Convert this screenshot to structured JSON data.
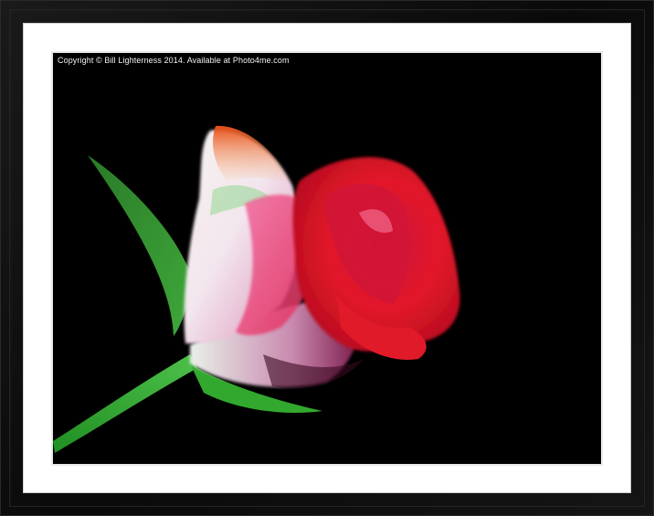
{
  "photo": {
    "watermark": "Copyright © Bill Lighterness 2014. Available at Photo4me.com",
    "subject": "rose-bud",
    "colors": {
      "background": "#000000",
      "frame": "#111111",
      "mount": "#ffffff",
      "petal_red": "#e0142a",
      "petal_pink": "#e85a8a",
      "petal_white": "#f4eaf0",
      "petal_orange": "#ee6a1e",
      "stem_green": "#2fa62a"
    }
  }
}
